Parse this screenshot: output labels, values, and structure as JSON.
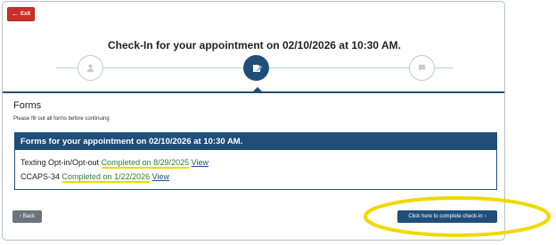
{
  "header": {
    "exit_label": "Exit",
    "title": "Check-In for your appointment on 02/10/2026 at 10:30 AM."
  },
  "stepper": {
    "steps": [
      {
        "icon": "user-icon",
        "state": "completed"
      },
      {
        "icon": "form-icon",
        "state": "active"
      },
      {
        "icon": "message-icon",
        "state": "upcoming"
      }
    ]
  },
  "forms": {
    "heading": "Forms",
    "instructions": "Please fill out all forms before continuing",
    "panel_title": "Forms for your appointment on 02/10/2026 at 10:30 AM.",
    "items": [
      {
        "name": "Texting Opt-in/Opt-out",
        "status": "Completed on 8/29/2025",
        "link": "View"
      },
      {
        "name": "CCAPS-34",
        "status": "Completed on 1/22/2026",
        "link": "View"
      }
    ]
  },
  "footer": {
    "back_label": "Back",
    "complete_label": "Click here to complete check-in"
  },
  "colors": {
    "primary": "#1f4e79",
    "exit": "#c9302c",
    "completed_text": "#2e7d32",
    "highlight": "#f0d800"
  }
}
